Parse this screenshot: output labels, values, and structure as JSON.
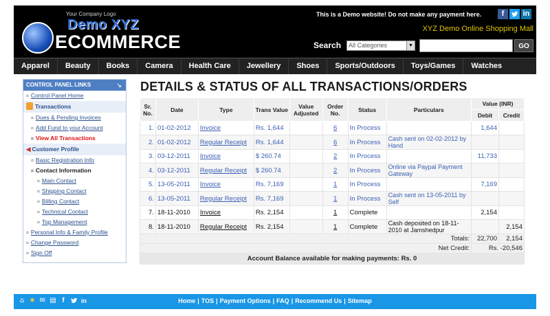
{
  "header": {
    "tagline": "Your Company Logo",
    "logo_line1": "Demo XYZ",
    "logo_line2": "ECOMMERCE",
    "demo_note": "This is a Demo website! Do not make any payment here.",
    "social": [
      "f",
      "t",
      "in"
    ],
    "mall_name": "XYZ Demo Online Shopping Mall",
    "search_label": "Search",
    "category_selected": "All Categories",
    "go_label": "GO"
  },
  "nav": [
    "Apparel",
    "Beauty",
    "Books",
    "Camera",
    "Health Care",
    "Jewellery",
    "Shoes",
    "Sports/Outdoors",
    "Toys/Games",
    "Watches"
  ],
  "sidebar": {
    "title": "CONTROL PANEL LINKS",
    "control_panel_home": "Control Panel Home",
    "transactions": "Transactions",
    "dues": "Dues & Pending Invoices",
    "add_fund": "Add Fund to your Account",
    "view_all": "View All Transactions",
    "customer_profile": "Customer Profile",
    "basic_reg": "Basic Registration Info",
    "contact_info": "Contact Information",
    "main_contact": "Main Contact",
    "shipping_contact": "Shipping Contact",
    "billing_contact": "Billing Contact",
    "technical_contact": "Technical Contact",
    "top_management": "Top Management",
    "personal_info": "Personal Info & Family Profile",
    "change_password": "Change Password",
    "sign_off": "Sign Off"
  },
  "main": {
    "title": "DETAILS & STATUS OF ALL TRANSACTIONS/ORDERS",
    "columns": {
      "sr": "Sr. No.",
      "date": "Date",
      "type": "Type",
      "trans_value": "Trans Value",
      "value_adjusted": "Value Adjusted",
      "order_no": "Order No.",
      "status": "Status",
      "particulars": "Particulars",
      "value_inr": "Value (INR)",
      "debit": "Debit",
      "credit": "Credit"
    },
    "rows": [
      {
        "sr": "1.",
        "date": "01-02-2012",
        "type": "Invoice",
        "value": "Rs. 1,644",
        "adjusted": "",
        "order": "6",
        "status": "In Process",
        "particulars": "",
        "debit": "1,644",
        "credit": ""
      },
      {
        "sr": "2.",
        "date": "01-02-2012",
        "type": "Regular Receipt",
        "value": "Rs. 1,644",
        "adjusted": "",
        "order": "6",
        "status": "In Process",
        "particulars": "Cash sent on 02-02-2012 by Hand",
        "debit": "",
        "credit": ""
      },
      {
        "sr": "3.",
        "date": "03-12-2011",
        "type": "Invoice",
        "value": "$ 260.74",
        "adjusted": "",
        "order": "2",
        "status": "In Process",
        "particulars": "",
        "debit": "11,733",
        "credit": ""
      },
      {
        "sr": "4.",
        "date": "03-12-2011",
        "type": "Regular Receipt",
        "value": "$ 260.74",
        "adjusted": "",
        "order": "2",
        "status": "In Process",
        "particulars": "Online via Paypal Payment Gateway",
        "debit": "",
        "credit": ""
      },
      {
        "sr": "5.",
        "date": "13-05-2011",
        "type": "Invoice",
        "value": "Rs. 7,169",
        "adjusted": "",
        "order": "1",
        "status": "In Process",
        "particulars": "",
        "debit": "7,169",
        "credit": ""
      },
      {
        "sr": "6.",
        "date": "13-05-2011",
        "type": "Regular Receipt",
        "value": "Rs. 7,169",
        "adjusted": "",
        "order": "1",
        "status": "In Process",
        "particulars": "Cash sent on 13-05-2011 by Self",
        "debit": "",
        "credit": ""
      },
      {
        "sr": "7.",
        "date": "18-11-2010",
        "type": "Invoice",
        "value": "Rs. 2,154",
        "adjusted": "",
        "order": "1",
        "status": "Complete",
        "particulars": "",
        "debit": "2,154",
        "credit": ""
      },
      {
        "sr": "8.",
        "date": "18-11-2010",
        "type": "Regular Receipt",
        "value": "Rs. 2,154",
        "adjusted": "",
        "order": "1",
        "status": "Complete",
        "particulars": "Cash deposited on 18-11-2010 at Jamshedpur",
        "debit": "",
        "credit": "2,154"
      }
    ],
    "totals_label": "Totals:",
    "totals_debit": "22,700",
    "totals_credit": "2,154",
    "net_credit_label": "Net Credit:",
    "net_credit_value": "Rs. -20,546",
    "balance_note": "Account Balance available for making payments: Rs. 0"
  },
  "footer": {
    "links": [
      "Home",
      "TOS",
      "Payment Options",
      "FAQ",
      "Recommend Us",
      "Sitemap"
    ],
    "icons": [
      "home-icon",
      "star-icon",
      "mail-icon",
      "print-icon",
      "facebook-icon",
      "twitter-icon",
      "linkedin-icon"
    ]
  },
  "colors": {
    "header_bg": "#000000",
    "logo_blue": "#2f6fd6",
    "mall_yellow": "#e3c700",
    "nav_bg": "#222222",
    "sidebar_head": "#4f7fc3",
    "active_red": "#dd1111",
    "footer_bg": "#1a96e6"
  }
}
